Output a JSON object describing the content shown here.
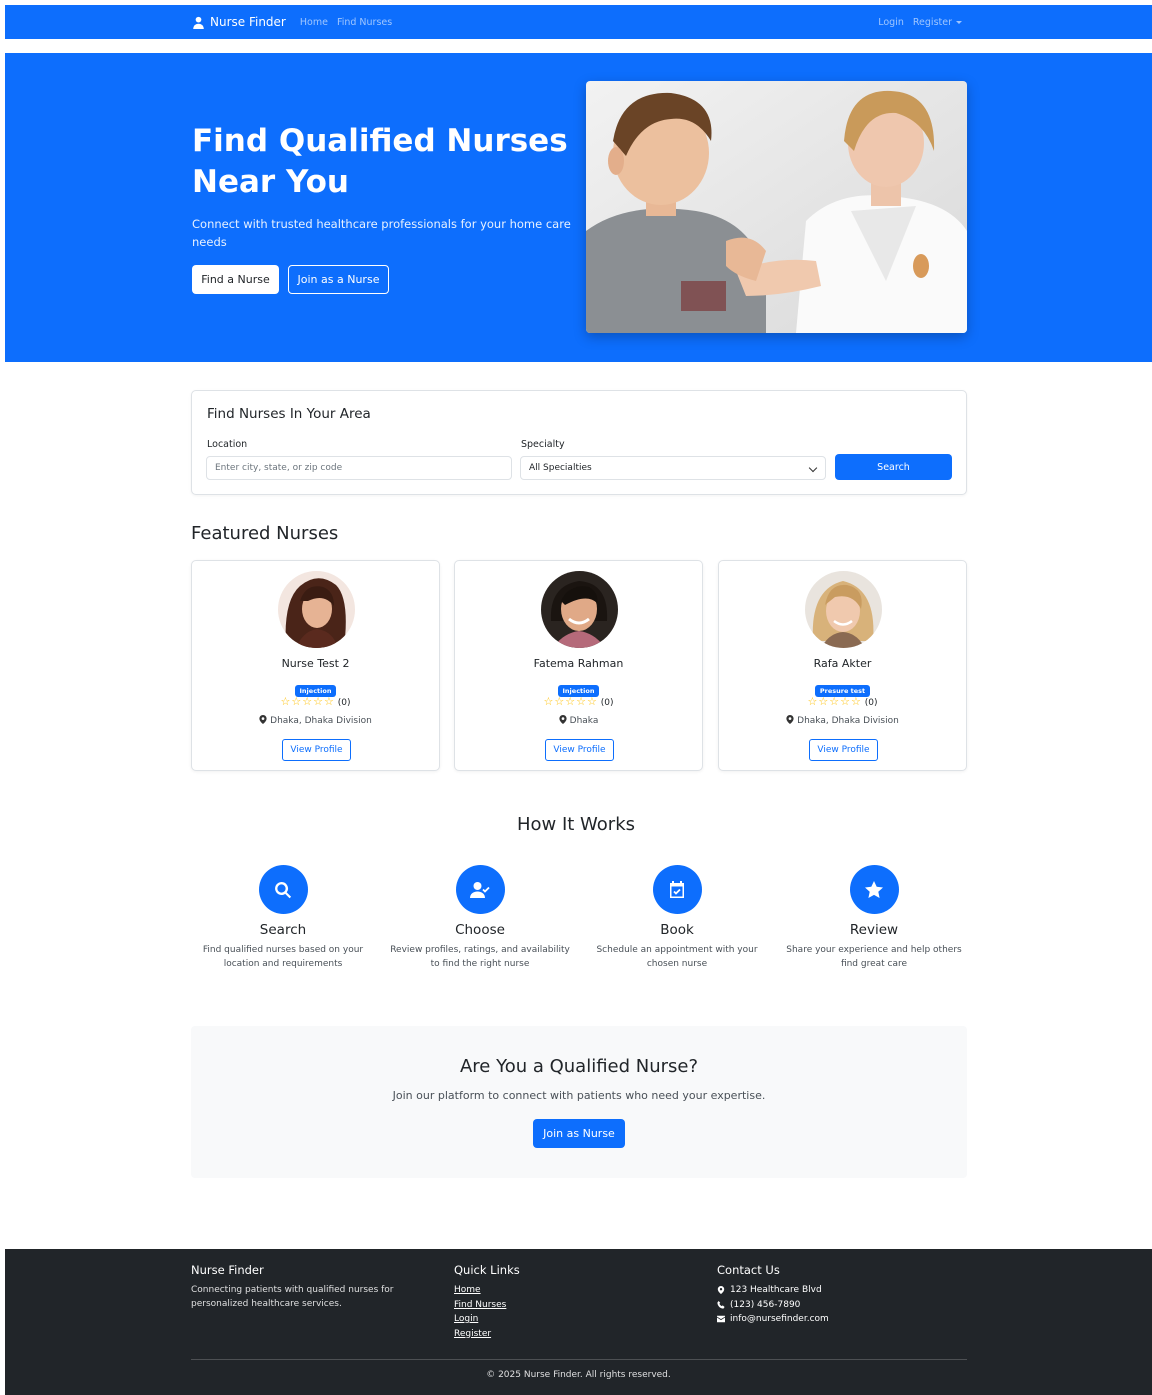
{
  "navbar": {
    "brand": "Nurse Finder",
    "links": [
      "Home",
      "Find Nurses"
    ],
    "login": "Login",
    "register": "Register"
  },
  "hero": {
    "title": "Find Qualified Nurses Near You",
    "subtitle": "Connect with trusted healthcare professionals for your home care needs",
    "find_button": "Find a Nurse",
    "join_button": "Join as a Nurse"
  },
  "search": {
    "title": "Find Nurses In Your Area",
    "location_label": "Location",
    "location_placeholder": "Enter city, state, or zip code",
    "specialty_label": "Specialty",
    "specialty_selected": "All Specialties",
    "button": "Search"
  },
  "featured": {
    "title": "Featured Nurses",
    "nurses": [
      {
        "name": "Nurse Test 2",
        "specialty": "Injection",
        "stars": "☆☆☆☆☆",
        "rating_count": "(0)",
        "location": "Dhaka, Dhaka Division",
        "button": "View Profile"
      },
      {
        "name": "Fatema Rahman",
        "specialty": "Injection",
        "stars": "☆☆☆☆☆",
        "rating_count": "(0)",
        "location": "Dhaka",
        "button": "View Profile"
      },
      {
        "name": "Rafa Akter",
        "specialty": "Presure test",
        "stars": "☆☆☆☆☆",
        "rating_count": "(0)",
        "location": "Dhaka, Dhaka Division",
        "button": "View Profile"
      }
    ]
  },
  "how_it_works": {
    "title": "How It Works",
    "steps": [
      {
        "icon": "search-icon",
        "title": "Search",
        "desc": "Find qualified nurses based on your location and requirements"
      },
      {
        "icon": "user-check-icon",
        "title": "Choose",
        "desc": "Review profiles, ratings, and availability to find the right nurse"
      },
      {
        "icon": "calendar-check-icon",
        "title": "Book",
        "desc": "Schedule an appointment with your chosen nurse"
      },
      {
        "icon": "star-icon",
        "title": "Review",
        "desc": "Share your experience and help others find great care"
      }
    ]
  },
  "cta": {
    "title": "Are You a Qualified Nurse?",
    "subtitle": "Join our platform to connect with patients who need your expertise.",
    "button": "Join as Nurse"
  },
  "footer": {
    "about_title": "Nurse Finder",
    "about_text": "Connecting patients with qualified nurses for personalized healthcare services.",
    "links_title": "Quick Links",
    "links": [
      "Home",
      "Find Nurses",
      "Login",
      "Register"
    ],
    "contact_title": "Contact Us",
    "address": "123 Healthcare Blvd",
    "phone": "(123) 456-7890",
    "email": "info@nursefinder.com",
    "copyright": "© 2025 Nurse Finder. All rights reserved."
  },
  "colors": {
    "primary": "#0d6efd",
    "footer_bg": "#212529",
    "star": "#ffc107",
    "cta_bg": "#f8f9fa"
  }
}
